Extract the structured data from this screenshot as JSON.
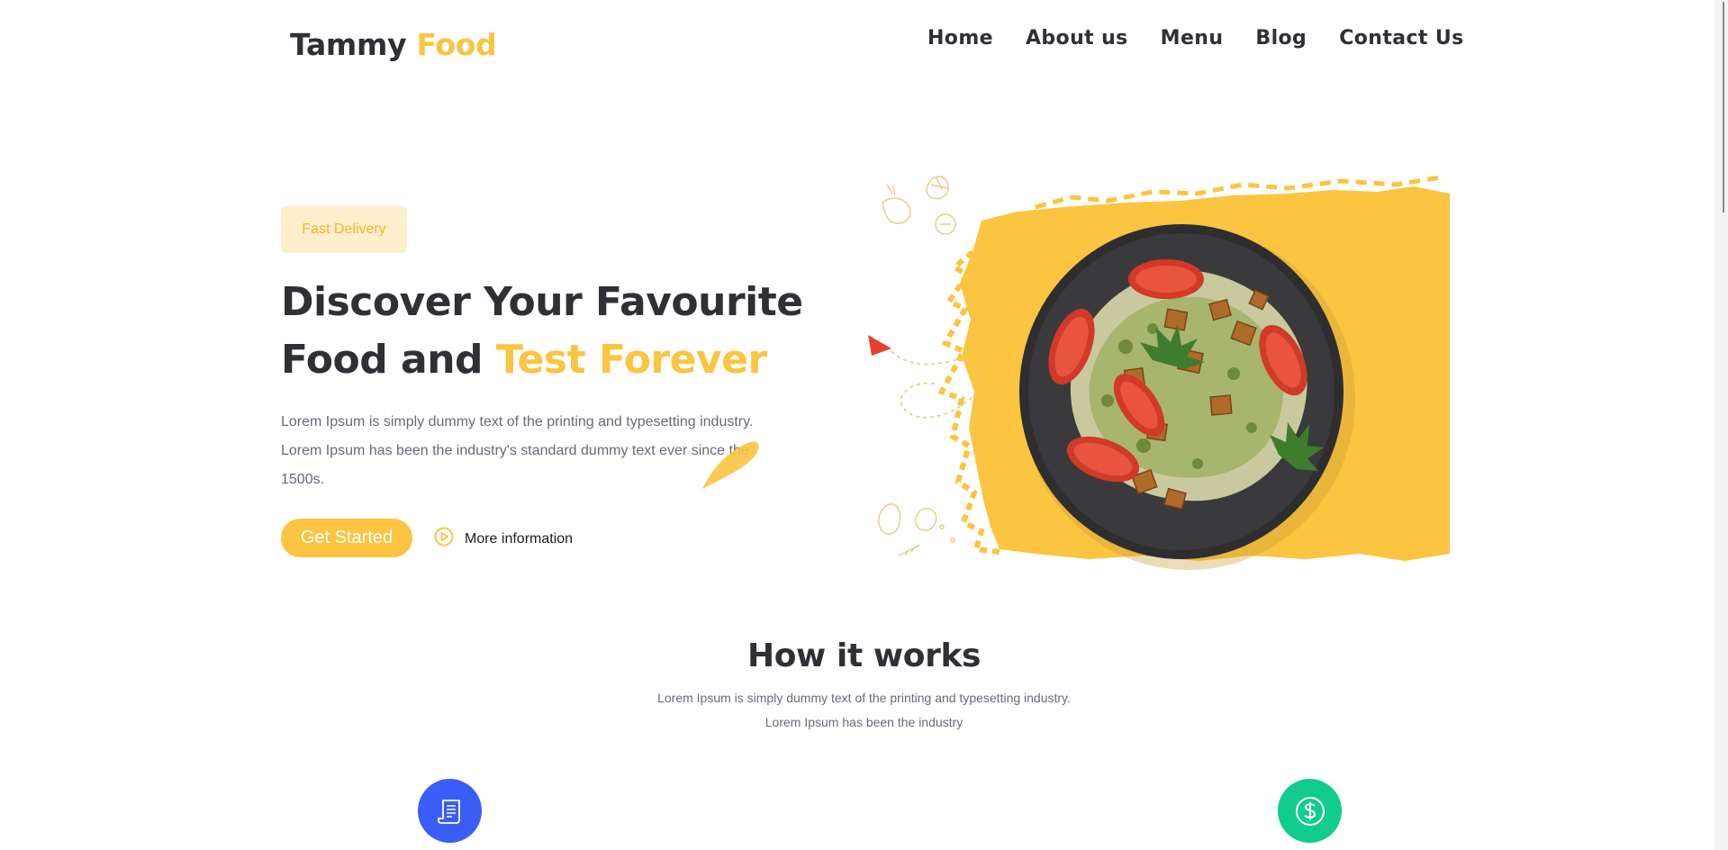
{
  "brand": {
    "name_part1": "Tammy",
    "name_part2": "Food",
    "accent": "#fbc441",
    "dark": "#2f2f35"
  },
  "nav": {
    "items": [
      "Home",
      "About us",
      "Menu",
      "Blog",
      "Contact Us"
    ]
  },
  "hero": {
    "badge": "Fast Delivery",
    "headline_line1": "Discover Your Favourite",
    "headline_line2_plain": "Food and",
    "headline_line2_highlight": "Test Forever",
    "description": "Lorem Ipsum is simply dummy text of the printing and typesetting industry. Lorem Ipsum has been the industry's standard dummy text ever since the 1500s.",
    "primary_button": "Get Started",
    "secondary_link": "More information"
  },
  "how_it_works": {
    "title": "How it works",
    "subtitle_line1": "Lorem Ipsum is simply dummy text of the printing and typesetting industry.",
    "subtitle_line2": "Lorem Ipsum has been the industry",
    "icons": [
      {
        "icon": "receipt-icon",
        "color": "#3b5ef8"
      },
      {
        "icon": "dollar-icon",
        "color": "#11cc8d"
      }
    ]
  }
}
